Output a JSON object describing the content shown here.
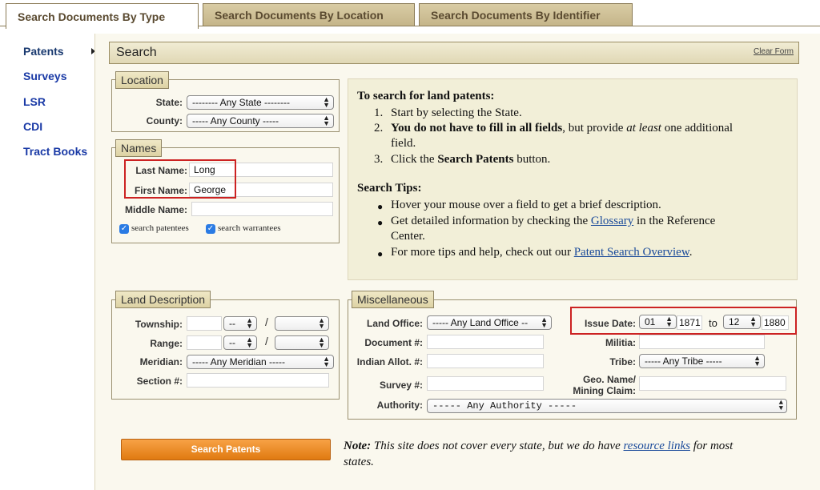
{
  "tabs": [
    {
      "label": "Search Documents By Type",
      "active": true
    },
    {
      "label": "Search Documents By Location",
      "active": false
    },
    {
      "label": "Search Documents By Identifier",
      "active": false
    }
  ],
  "nav": {
    "items": [
      {
        "label": "Patents",
        "active": true
      },
      {
        "label": "Surveys"
      },
      {
        "label": "LSR"
      },
      {
        "label": "CDI"
      },
      {
        "label": "Tract Books"
      }
    ]
  },
  "search_bar": {
    "title": "Search",
    "clear_label": "Clear Form"
  },
  "location": {
    "legend": "Location",
    "state_label": "State:",
    "state_value": "-------- Any State --------",
    "county_label": "County:",
    "county_value": "----- Any County -----"
  },
  "names": {
    "legend": "Names",
    "last_label": "Last Name:",
    "last_value": "Long",
    "first_label": "First Name:",
    "first_value": "George",
    "middle_label": "Middle Name:",
    "middle_value": "",
    "cb_patentees": "search patentees",
    "cb_warrantees": "search warrantees"
  },
  "instructions": {
    "heading": "To search for land patents:",
    "steps": [
      "Start by selecting the State.",
      "",
      "Click the"
    ],
    "step2_bold": "You do not have to fill in all fields",
    "step2_rest1": ", but provide ",
    "step2_italic": "at least",
    "step2_rest2": " one additional",
    "step2_line2": "field.",
    "step3_bold": "Search Patents",
    "step3_rest": " button.",
    "tips_heading": "Search Tips:",
    "tip1": "Hover your mouse over a field to get a brief description.",
    "tip2_a": "Get detailed information by checking the ",
    "tip2_link": "Glossary",
    "tip2_b": " in the Reference",
    "tip2_line2": "Center.",
    "tip3_a": "For more tips and help, check out our ",
    "tip3_link": "Patent Search Overview",
    "tip3_b": "."
  },
  "land": {
    "legend": "Land Description",
    "township_label": "Township:",
    "township_dir": "--",
    "range_label": "Range:",
    "range_dir": "--",
    "slash": "/",
    "meridian_label": "Meridian:",
    "meridian_value": "----- Any Meridian -----",
    "section_label": "Section #:"
  },
  "misc": {
    "legend": "Miscellaneous",
    "land_office_label": "Land Office:",
    "land_office_value": "----- Any Land Office --",
    "document_label": "Document #:",
    "indian_label": "Indian Allot. #:",
    "survey_label": "Survey #:",
    "authority_label": "Authority:",
    "authority_value": "----- Any Authority -----",
    "issue_label": "Issue Date:",
    "issue_month_from": "01",
    "issue_year_from": "1871",
    "to_label": "to",
    "issue_month_to": "12",
    "issue_year_to": "1880",
    "militia_label": "Militia:",
    "tribe_label": "Tribe:",
    "tribe_value": "----- Any Tribe -----",
    "geo_label_1": "Geo. Name/",
    "geo_label_2": "Mining Claim:"
  },
  "search_button": "Search Patents",
  "note": {
    "bold": "Note:",
    "text1": " This site does not cover every state, but we do have ",
    "link": "resource links",
    "text2": " for most",
    "text3": "states."
  }
}
